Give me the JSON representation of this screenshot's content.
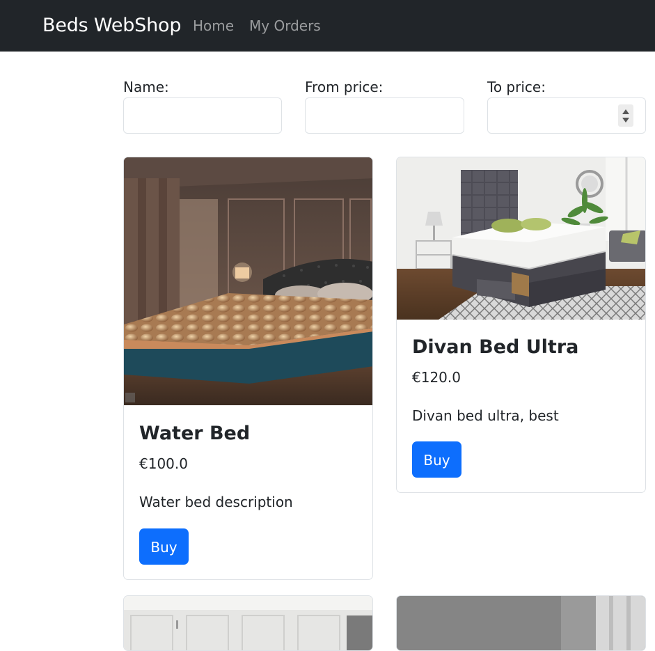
{
  "navbar": {
    "brand": "Beds WebShop",
    "links": [
      {
        "label": "Home"
      },
      {
        "label": "My Orders"
      }
    ]
  },
  "filters": {
    "name_label": "Name:",
    "name_value": "",
    "from_price_label": "From price:",
    "from_price_value": "",
    "to_price_label": "To price:",
    "to_price_value": ""
  },
  "products": [
    {
      "title": "Water Bed",
      "price": "€100.0",
      "description": "Water bed description",
      "buy_label": "Buy"
    },
    {
      "title": "Divan Bed Ultra",
      "price": "€120.0",
      "description": "Divan bed ultra, best",
      "buy_label": "Buy"
    }
  ],
  "colors": {
    "navbar_bg": "#212529",
    "primary": "#0d6efd",
    "border": "#dee2e6"
  }
}
